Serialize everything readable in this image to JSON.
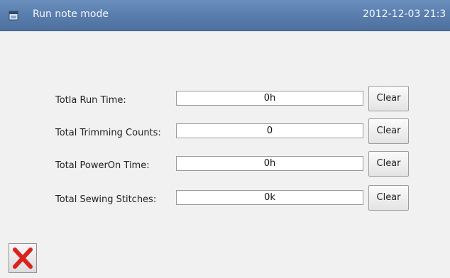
{
  "titlebar": {
    "title": "Run note mode",
    "datetime": "2012-12-03  21:3",
    "icon": "window-icon"
  },
  "rows": [
    {
      "label": "Totla Run Time:",
      "value": "0h",
      "button": "Clear"
    },
    {
      "label": "Total Trimming Counts:",
      "value": "0",
      "button": "Clear"
    },
    {
      "label": "Total PowerOn Time:",
      "value": "0h",
      "button": "Clear"
    },
    {
      "label": "Total Sewing Stitches:",
      "value": "0k",
      "button": "Clear"
    }
  ],
  "close_button": {
    "icon": "close-x-icon",
    "color": "#d9231f"
  },
  "colors": {
    "titlebar": "#5a7eae",
    "background": "#f1f1f1"
  }
}
